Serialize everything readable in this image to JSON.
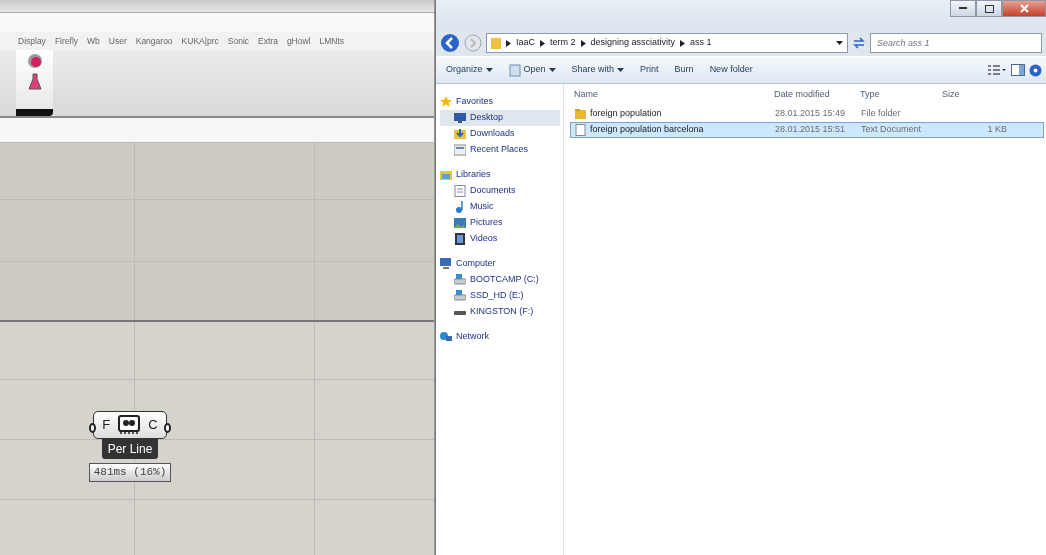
{
  "grasshopper": {
    "tabs": [
      "Display",
      "Firefly",
      "Wb",
      "User",
      "Kangaroo",
      "KUKA|prc",
      "Sonic",
      "Extra",
      "gHowl",
      "LMNts"
    ],
    "component": {
      "input": "F",
      "output": "C",
      "name": "Per Line",
      "timing": "481ms (16%)"
    }
  },
  "explorer": {
    "breadcrumb": [
      "IaaC",
      "term 2",
      "designing assciativity",
      "ass 1"
    ],
    "search": {
      "placeholder": "Search ass 1"
    },
    "toolbar": [
      {
        "label": "Organize",
        "dropdown": true
      },
      {
        "label": "Open",
        "dropdown": true,
        "kind": "open"
      },
      {
        "label": "Share with",
        "dropdown": true
      },
      {
        "label": "Print",
        "dropdown": false
      },
      {
        "label": "Burn",
        "dropdown": false
      },
      {
        "label": "New folder",
        "dropdown": false
      }
    ],
    "nav": [
      {
        "label": "Favorites",
        "kind": "star",
        "children": [
          {
            "label": "Desktop",
            "kind": "desktop",
            "selected": true
          },
          {
            "label": "Downloads",
            "kind": "downloads",
            "selected": false
          },
          {
            "label": "Recent Places",
            "kind": "recent",
            "selected": false
          }
        ]
      },
      {
        "label": "Libraries",
        "kind": "library",
        "children": [
          {
            "label": "Documents",
            "kind": "document",
            "selected": false
          },
          {
            "label": "Music",
            "kind": "music",
            "selected": false
          },
          {
            "label": "Pictures",
            "kind": "pictures",
            "selected": false
          },
          {
            "label": "Videos",
            "kind": "videos",
            "selected": false
          }
        ]
      },
      {
        "label": "Computer",
        "kind": "computer",
        "children": [
          {
            "label": "BOOTCAMP (C:)",
            "kind": "drive",
            "selected": false
          },
          {
            "label": "SSD_HD (E:)",
            "kind": "drive",
            "selected": false
          },
          {
            "label": "KINGSTON (F:)",
            "kind": "usb",
            "selected": false
          }
        ]
      },
      {
        "label": "Network",
        "kind": "network"
      }
    ],
    "columns": [
      "Name",
      "Date modified",
      "Type",
      "Size"
    ],
    "files": [
      {
        "kind": "folder",
        "name": "foreign population",
        "date": "28.01.2015 15:49",
        "type": "File folder",
        "selected": false
      },
      {
        "kind": "text",
        "name": "foreign population barcelona",
        "date": "28.01.2015 15:51",
        "type": "Text Document",
        "size": "1 KB",
        "selected": true
      }
    ]
  }
}
